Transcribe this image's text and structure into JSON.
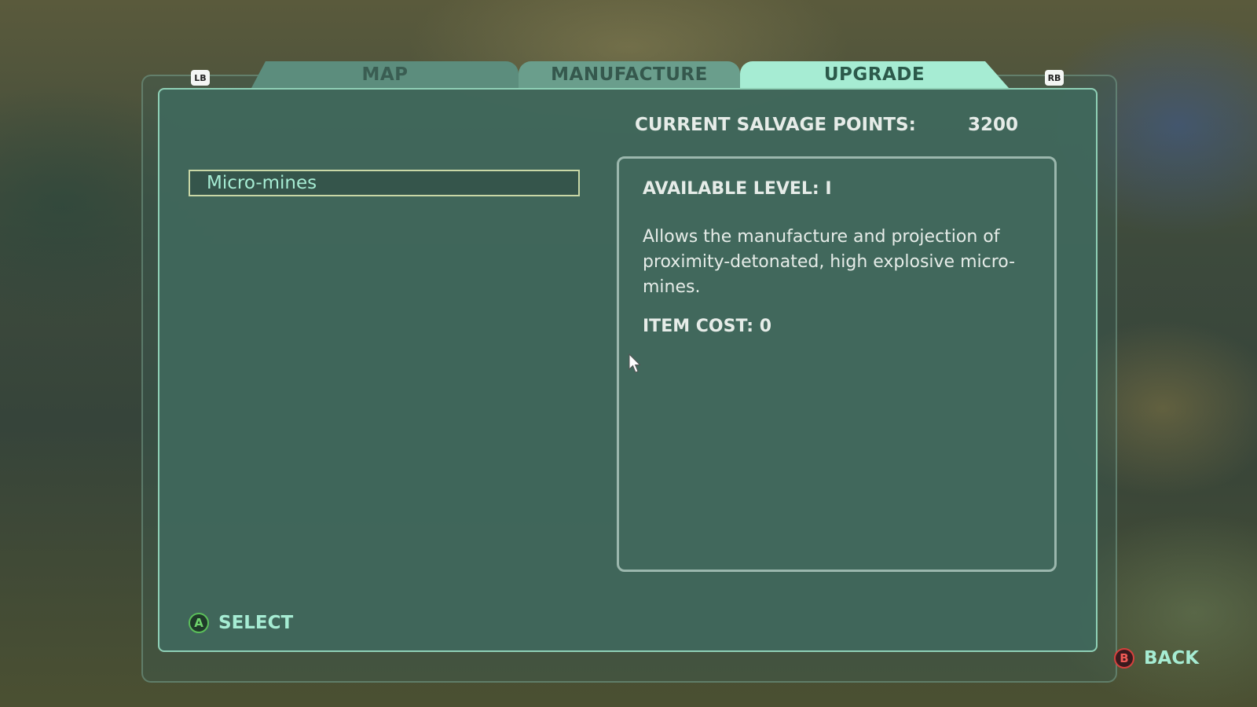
{
  "tabs": [
    {
      "label": "MAP",
      "active": false
    },
    {
      "label": "MANUFACTURE",
      "active": false
    },
    {
      "label": "UPGRADE",
      "active": true
    }
  ],
  "bumpers": {
    "left": "LB",
    "right": "RB"
  },
  "salvage": {
    "label": "CURRENT SALVAGE POINTS:",
    "value": "3200"
  },
  "list": {
    "items": [
      {
        "label": "Micro-mines",
        "selected": true
      }
    ]
  },
  "details": {
    "available_level": "AVAILABLE LEVEL: I",
    "description": "Allows the manufacture and projection of proximity-detonated, high explosive micro-mines.",
    "item_cost": "ITEM COST: 0"
  },
  "prompts": {
    "select": {
      "button": "A",
      "label": "SELECT"
    },
    "back": {
      "button": "B",
      "label": "BACK"
    }
  },
  "colors": {
    "accent": "#a6ecd3",
    "panel": "#40685c",
    "a_button": "#5bbf5a",
    "b_button": "#d6403d"
  }
}
